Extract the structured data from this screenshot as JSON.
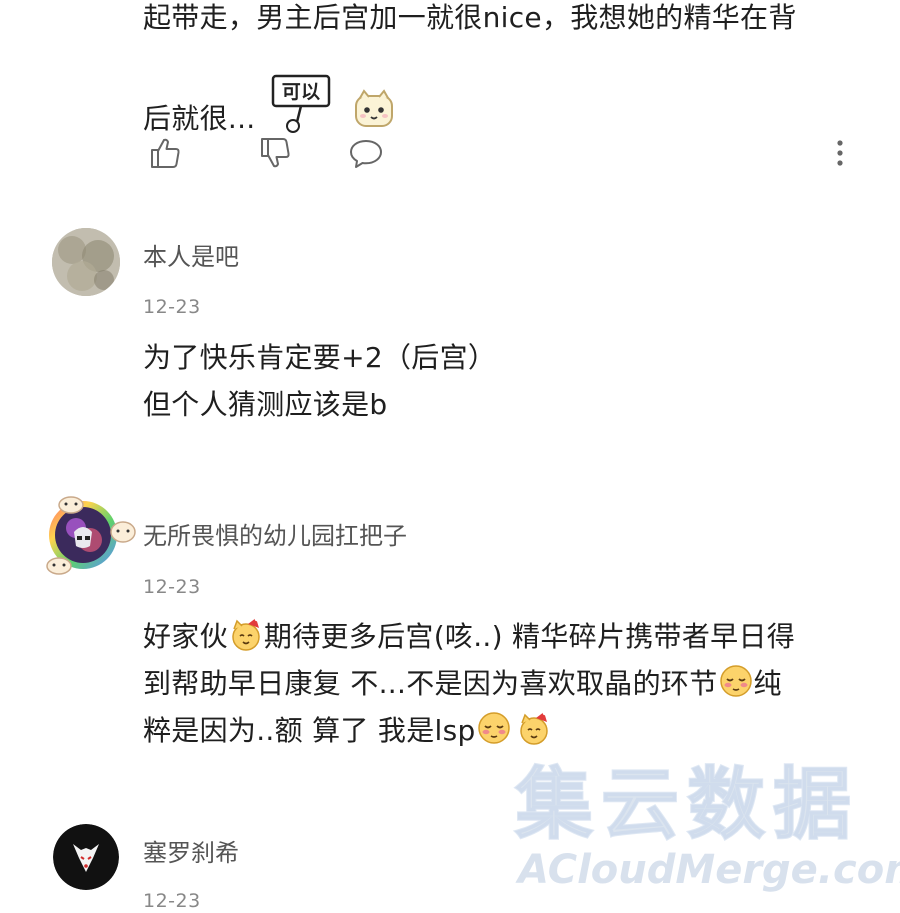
{
  "top_comment": {
    "line1": "起带走，男主后宫加一就很nice，我想她的精华在背",
    "line2": "后就很...",
    "sign_sticker_text": "可以",
    "actions": [
      "like-icon",
      "dislike-icon",
      "reply-icon",
      "more-icon"
    ]
  },
  "comments": [
    {
      "username": "本人是吧",
      "date": "12-23",
      "line1": "为了快乐肯定要+2（后宫）",
      "line2": "但个人猜测应该是b"
    },
    {
      "username": "无所畏惧的幼儿园扛把子",
      "date": "12-23",
      "line1_a": "好家伙",
      "line1_b": "期待更多后宫(咳..) 精华碎片携带者早日得",
      "line2_a": "到帮助早日康复 不...不是因为喜欢取晶的环节",
      "line2_b": "纯",
      "line3_a": "粹是因为..额 算了 我是lsp"
    },
    {
      "username": "塞罗刹希",
      "date": "12-23"
    }
  ],
  "watermark": {
    "cn": "集云数据",
    "en": "ACloudMerge.com"
  },
  "colors": {
    "text": "#1f1f1f",
    "meta": "#888888",
    "icon": "#666666"
  }
}
